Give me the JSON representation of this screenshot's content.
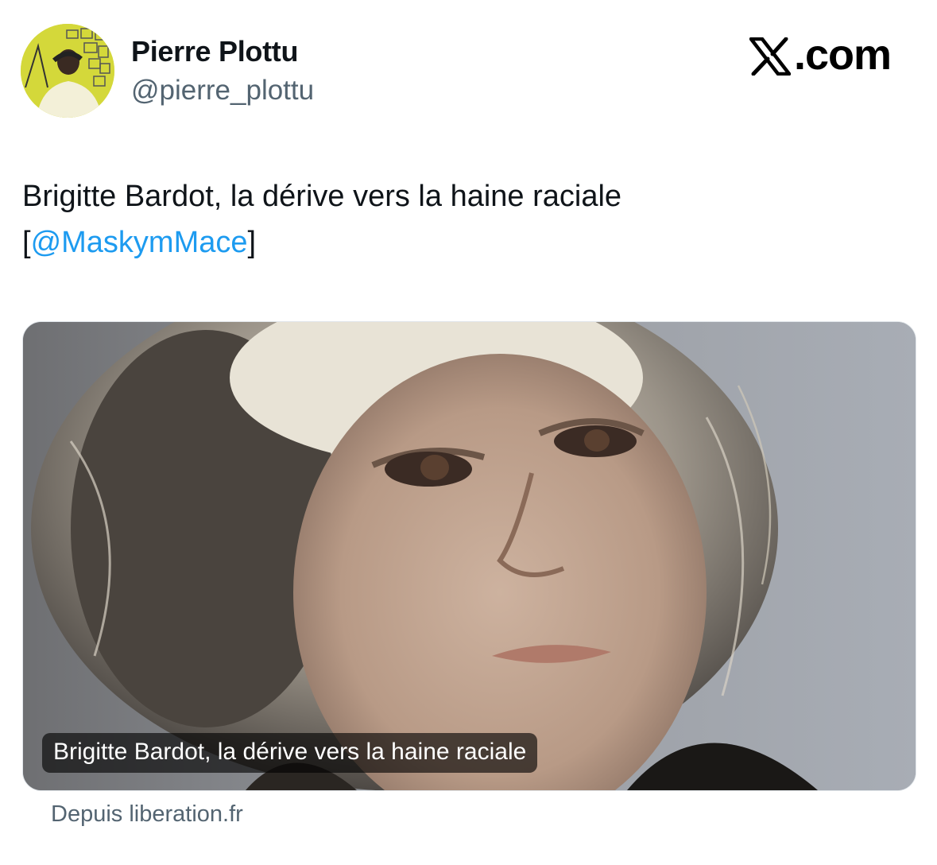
{
  "author": {
    "display_name": "Pierre Plottu",
    "handle": "@pierre_plottu"
  },
  "brand": {
    "label": ".com",
    "icon": "x-logo-icon"
  },
  "tweet": {
    "line1": "Brigitte Bardot, la dérive vers la haine raciale",
    "bracket_open": "[",
    "mention": "@MaskymMace",
    "bracket_close": "]"
  },
  "card": {
    "caption": "Brigitte Bardot, la dérive vers la haine raciale",
    "source": "Depuis liberation.fr"
  },
  "colors": {
    "link": "#1d9bf0",
    "secondary_text": "#536471",
    "primary_text": "#0f1419"
  }
}
